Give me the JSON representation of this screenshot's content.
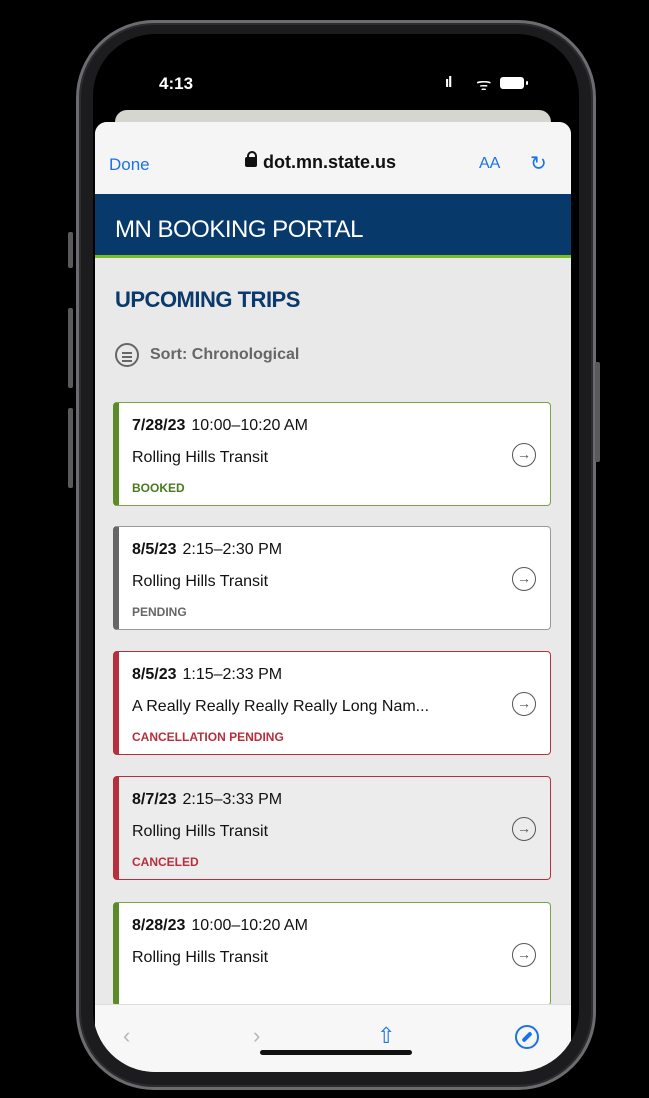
{
  "status_bar": {
    "time": "4:13",
    "signal": "ıl",
    "wifi": "ᯤ"
  },
  "browser": {
    "done_label": "Done",
    "url": "dot.mn.state.us",
    "aa_label": "AA",
    "reload_icon": "↻"
  },
  "page": {
    "brand_title": "MN BOOKING PORTAL",
    "heading": "UPCOMING TRIPS",
    "sort_label": "Sort: Chronological"
  },
  "trips": [
    {
      "date": "7/28/23",
      "time": "10:00–10:20 AM",
      "name": "Rolling Hills Transit",
      "status": "BOOKED",
      "status_color": "#4a7a1e"
    },
    {
      "date": "8/5/23",
      "time": "2:15–2:30 PM",
      "name": "Rolling Hills Transit",
      "status": "PENDING",
      "status_color": "#666666"
    },
    {
      "date": "8/5/23",
      "time": "1:15–2:33 PM",
      "name": "A Really Really Really Really Long Nam...",
      "status": "CANCELLATION PENDING",
      "status_color": "#b5303c"
    },
    {
      "date": "8/7/23",
      "time": "2:15–3:33 PM",
      "name": "Rolling Hills Transit",
      "status": "CANCELED",
      "status_color": "#b5303c"
    },
    {
      "date": "8/28/23",
      "time": "10:00–10:20 AM",
      "name": "Rolling Hills Transit",
      "status": "",
      "status_color": "#4a7a1e"
    }
  ],
  "toolbar": {
    "back_icon": "‹",
    "forward_icon": "›",
    "share_icon": "⇧",
    "compass_icon": "compass"
  }
}
